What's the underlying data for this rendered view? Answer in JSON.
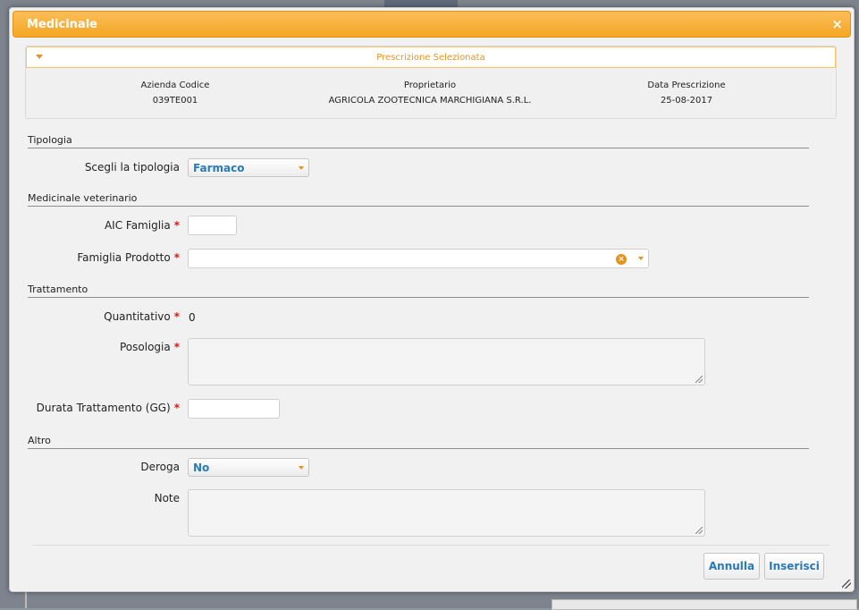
{
  "dialog": {
    "title": "Medicinale",
    "close_glyph": "×"
  },
  "prescription": {
    "header": "Prescrizione Selezionata",
    "columns": [
      {
        "label": "Azienda Codice",
        "value": "039TE001"
      },
      {
        "label": "Proprietario",
        "value": "AGRICOLA ZOOTECNICA MARCHIGIANA S.R.L."
      },
      {
        "label": "Data Prescrizione",
        "value": "25-08-2017"
      }
    ]
  },
  "sections": {
    "tipologia": "Tipologia",
    "medicinale": "Medicinale veterinario",
    "trattamento": "Trattamento",
    "altro": "Altro"
  },
  "fields": {
    "tipologia_label": "Scegli la tipologia",
    "tipologia_value": "Farmaco",
    "aic_label": "AIC Famiglia",
    "aic_value": "",
    "famiglia_label": "Famiglia Prodotto",
    "famiglia_value": "",
    "clear_glyph": "×",
    "quantitativo_label": "Quantitativo",
    "quantitativo_value": "0",
    "posologia_label": "Posologia",
    "posologia_value": "",
    "durata_label": "Durata Trattamento (GG)",
    "durata_value": "",
    "deroga_label": "Deroga",
    "deroga_value": "No",
    "note_label": "Note",
    "note_value": "",
    "required_mark": "*"
  },
  "buttons": {
    "cancel": "Annulla",
    "insert": "Inserisci"
  },
  "colors": {
    "accent": "#f5a623",
    "link": "#2a7ab8",
    "required": "#d9161c"
  }
}
